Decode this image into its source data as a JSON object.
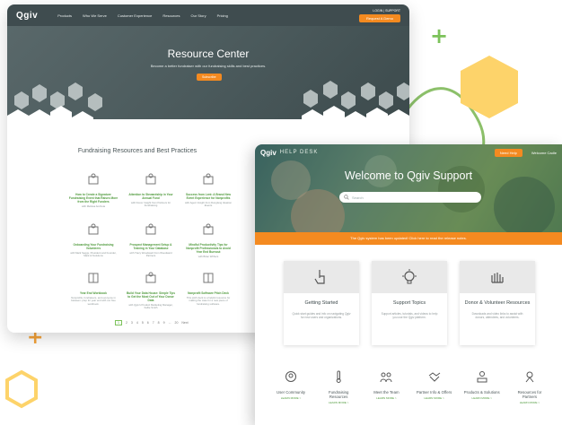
{
  "colors": {
    "accent_orange": "#f48a20",
    "accent_green": "#7cc25a",
    "hex_yellow": "#fdd36a"
  },
  "resource_center": {
    "logo": "Qgiv",
    "nav": [
      "Products",
      "Who We Serve",
      "Customer Experience",
      "Resources",
      "Our Story",
      "Pricing"
    ],
    "auth": "LOGIN | SUPPORT",
    "cta_top": "Request A Demo",
    "hero_title": "Resource Center",
    "hero_sub": "Become a better fundraiser with our fundraising skills and best practices.",
    "hero_button": "Subscribe",
    "section_title": "Fundraising Resources and Best Practices",
    "items": [
      {
        "title": "How to Create a Signature Fundraising Event that Raises More from the Right Funders",
        "desc": "with Melissa Ancheta"
      },
      {
        "title": "Attention to Stewardship in Your Annual Fund",
        "desc": "with Donor Insight from Partners for Fundraising"
      },
      {
        "title": "Success from Lent: A Brand New Event Experience for Nonprofits",
        "desc": "with Agent Insight from Dongfeng Ideation Events"
      },
      {
        "title": "Onboarding Your Fundraising Volunteers",
        "desc": "with Mark Seggs, President and Founder, Mark Ai Solutions"
      },
      {
        "title": "Prospect Management Setup & Training in Your Database",
        "desc": "with Tracy Woodward from Woodward Partners"
      },
      {
        "title": "Mindful Productivity Tips for Nonprofit Professionals to Avoid Year End Burnout",
        "desc": "with Brian Withers"
      },
      {
        "title": "Year End Workbook",
        "desc": "Nonprofits, fundraisers, and everyone in between: prep for year end with our free workbook."
      },
      {
        "title": "Build Your Data House: Simple Tips to Get the Most Out of Your Donor Data",
        "desc": "with Qgiv's Product Marketing Manager, Kellie Smith"
      },
      {
        "title": "Nonprofit Software Pitch Deck",
        "desc": "This pitch deck is a helpful resource for making the case for a new piece of fundraising software."
      }
    ],
    "pager": [
      "1",
      "2",
      "3",
      "4",
      "5",
      "6",
      "7",
      "8",
      "9",
      "...",
      "20",
      "Next"
    ]
  },
  "help_desk": {
    "logo": "Qgiv",
    "label": "HELP DESK",
    "ghelp": "Need Help",
    "welcome_cta": "Welcome Cadle",
    "hero_title": "Welcome to Qgiv Support",
    "search_placeholder": "Search",
    "banner": "The Qgiv system has been updated! Click here to read the release notes.",
    "cards": [
      {
        "title": "Getting Started",
        "desc": "Quick start guides and info on navigating Qgiv for new users and organizations.",
        "icon": "pointer-hand-icon"
      },
      {
        "title": "Support Topics",
        "desc": "Support articles, tutorials, and videos to help you use the Qgiv platform.",
        "icon": "lightbulb-icon"
      },
      {
        "title": "Donor & Volunteer Resources",
        "desc": "Downloads and video links to assist with donors, attendees, and volunteers.",
        "icon": "helping-hand-icon"
      }
    ],
    "links": [
      {
        "label": "User Community",
        "more": "LEARN MORE >",
        "icon": "community-icon"
      },
      {
        "label": "Fundraising Resources",
        "more": "LEARN MORE >",
        "icon": "thermometer-icon"
      },
      {
        "label": "Meet the Team",
        "more": "LEARN MORE >",
        "icon": "team-icon"
      },
      {
        "label": "Partner Info & Offers",
        "more": "LEARN MORE >",
        "icon": "handshake-icon"
      },
      {
        "label": "Products & Solutions",
        "more": "LEARN MORE >",
        "icon": "products-icon"
      },
      {
        "label": "Resources for Partners",
        "more": "LEARN MORE >",
        "icon": "partner-resources-icon"
      }
    ]
  }
}
